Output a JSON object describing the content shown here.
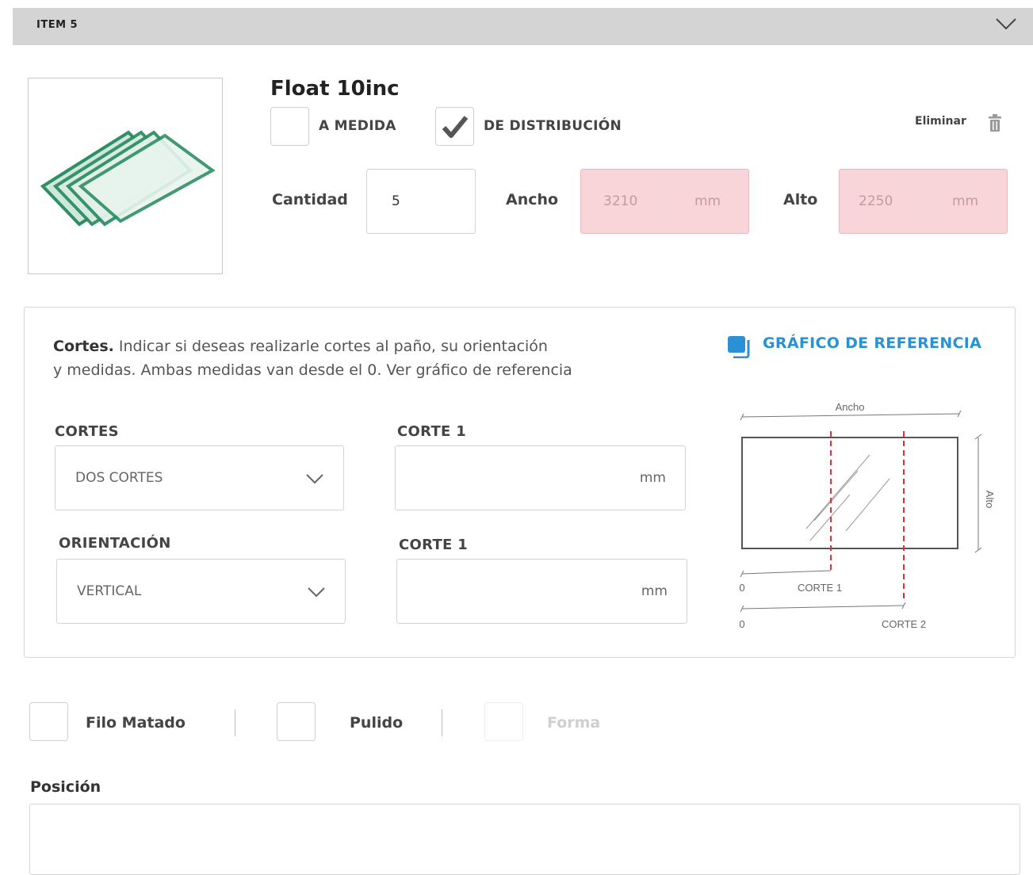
{
  "item": {
    "title": "ITEM 5"
  },
  "product": {
    "name": "Float 10inc",
    "options": {
      "a_medida": "A MEDIDA",
      "distribucion": "DE DISTRIBUCIÓN"
    },
    "distribucion_checked": true,
    "delete_label": "Eliminar"
  },
  "fields": {
    "cantidad_label": "Cantidad",
    "cantidad_value": "5",
    "ancho_label": "Ancho",
    "ancho_value": "3210",
    "ancho_unit": "mm",
    "alto_label": "Alto",
    "alto_value": "2250",
    "alto_unit": "mm"
  },
  "cortes": {
    "desc_bold": "Cortes.",
    "desc_line1": " Indicar si deseas realizarle cortes al paño, su orientación",
    "desc_line2": "y medidas. Ambas medidas van desde el 0. Ver gráfico de referencia",
    "ref_link": "GRÁFICO DE REFERENCIA",
    "cortes_label": "CORTES",
    "cortes_value": "DOS CORTES",
    "orient_label": "ORIENTACIÓN",
    "orient_value": "VERTICAL",
    "corte1_label": "CORTE 1",
    "corte1_unit": "mm",
    "corte2_label": "CORTE 1",
    "corte2_unit": "mm"
  },
  "diagram": {
    "ancho": "Ancho",
    "alto": "Alto",
    "zero1": "0",
    "corte1": "CORTE 1",
    "zero2": "0",
    "corte2": "CORTE 2",
    "accent": "#e0323a"
  },
  "extras": {
    "filo": "Filo Matado",
    "pulido": "Pulido",
    "forma": "Forma",
    "posicion_label": "Posición"
  }
}
